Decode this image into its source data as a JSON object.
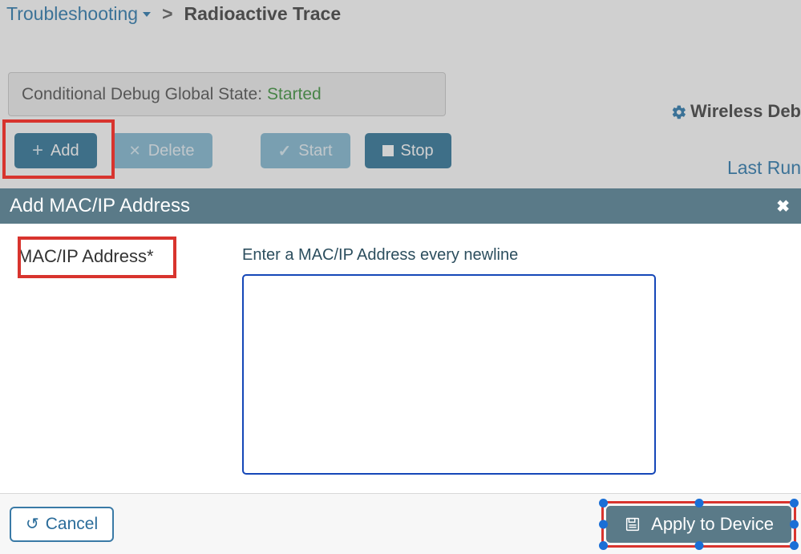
{
  "breadcrumb": {
    "parent": "Troubleshooting",
    "separator": ">",
    "current": "Radioactive Trace"
  },
  "status": {
    "label": "Conditional Debug Global State:",
    "value": "Started"
  },
  "toolbar": {
    "add": "Add",
    "delete": "Delete",
    "start": "Start",
    "stop": "Stop"
  },
  "right": {
    "wireless_debug": "Wireless Deb",
    "last_run": "Last Run"
  },
  "modal": {
    "title": "Add MAC/IP Address",
    "field_label": "MAC/IP Address*",
    "hint": "Enter a MAC/IP Address every newline",
    "textarea_value": "",
    "cancel": "Cancel",
    "apply": "Apply to Device"
  }
}
